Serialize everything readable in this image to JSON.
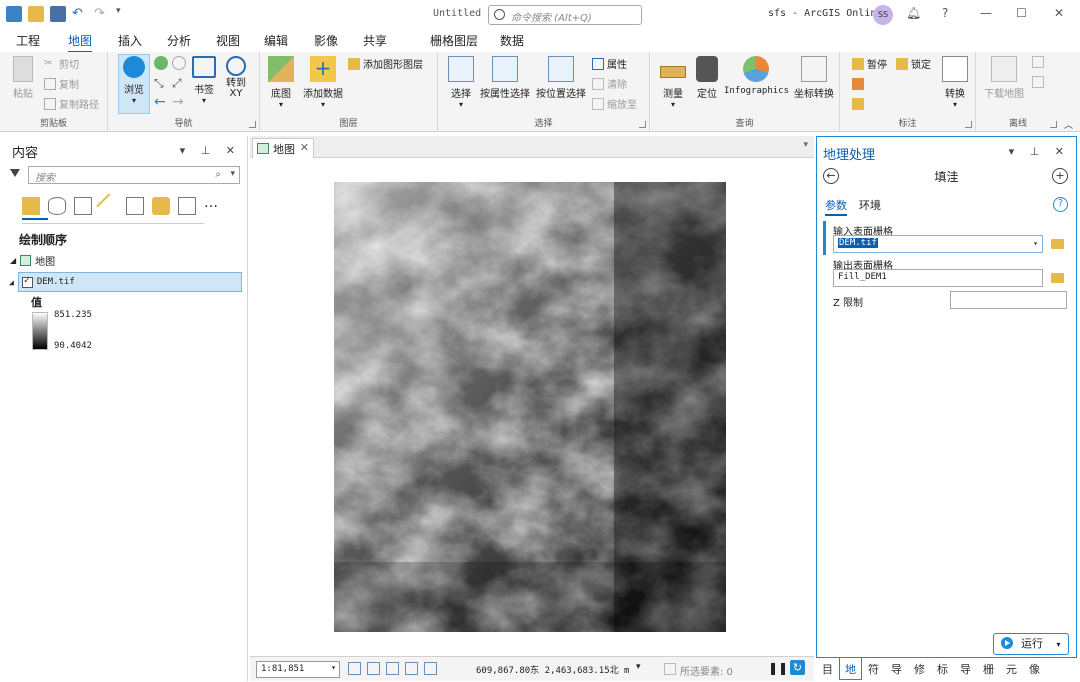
{
  "titlebar": {
    "doc_title": "Untitled",
    "search_placeholder": "命令搜索 (Alt+Q)",
    "right_text": "sfs - ArcGIS Online",
    "avatar": "SS",
    "help": "?"
  },
  "tabs": [
    "工程",
    "地图",
    "插入",
    "分析",
    "视图",
    "编辑",
    "影像",
    "共享",
    "栅格图层",
    "数据"
  ],
  "active_tab": "地图",
  "ribbon": {
    "clipboard": {
      "label": "剪贴板",
      "paste": "粘贴",
      "cut": "剪切",
      "copy": "复制",
      "copy_path": "复制路径"
    },
    "navigate": {
      "label": "导航",
      "explore": "浏览",
      "bookmarks": "书签",
      "goto_xy": "转到\nXY"
    },
    "layer": {
      "label": "图层",
      "basemap": "底图",
      "add_data": "添加数据",
      "add_graphics": "添加图形图层"
    },
    "selection": {
      "label": "选择",
      "select": "选择",
      "by_attr": "按属性选择",
      "by_loc": "按位置选择",
      "attributes": "属性",
      "clear": "清除",
      "zoom_to": "缩放至"
    },
    "inquiry": {
      "label": "查询",
      "measure": "测量",
      "locate": "定位",
      "infographics": "Infographics",
      "coord_conv": "坐标转换"
    },
    "labeling": {
      "label": "标注",
      "pause": "暂停",
      "lock": "锁定",
      "convert": "转换"
    },
    "offline": {
      "label": "离线",
      "download_map": "下载地图"
    }
  },
  "contents": {
    "title": "内容",
    "search_placeholder": "搜索",
    "drawing_order": "绘制顺序",
    "map_name": "地图",
    "layer_name": "DEM.tif",
    "legend_title": "值",
    "legend_high": "851.235",
    "legend_low": "90.4042"
  },
  "map_view": {
    "tab_label": "地图",
    "scale": "1:81,851",
    "coordinates": "609,867.80东 2,463,683.15北 m",
    "selected_features": "所选要素: 0"
  },
  "geoprocessing": {
    "title": "地理处理",
    "tool_name": "填洼",
    "tab_params": "参数",
    "tab_env": "环境",
    "input_label": "输入表面栅格",
    "input_value": "DEM.tif",
    "output_label": "输出表面栅格",
    "output_value": "Fill_DEM1",
    "z_label": "Z 限制",
    "run_label": "运行"
  },
  "bottom_tabs": [
    "目",
    "地",
    "符",
    "导",
    "修",
    "标",
    "导",
    "栅",
    "元",
    "像"
  ],
  "colors": {
    "accent": "#0b5fb3",
    "border_blue": "#1d8ad8",
    "folder": "#e7b949"
  }
}
